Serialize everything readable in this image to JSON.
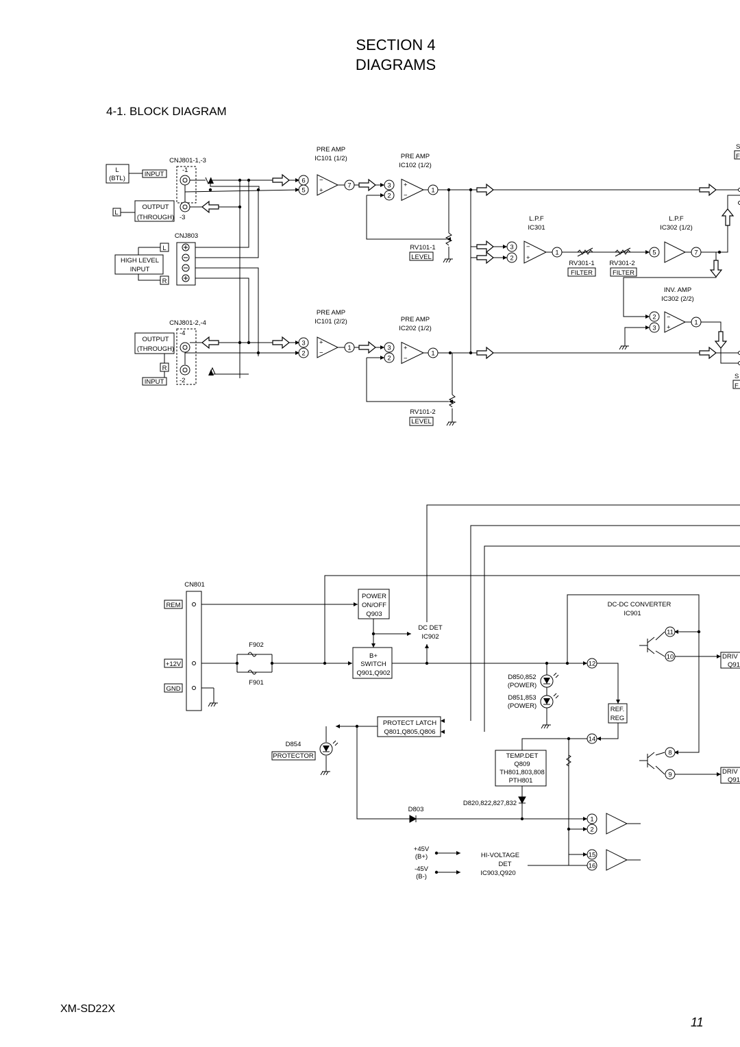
{
  "header": {
    "section": "SECTION 4",
    "title": "DIAGRAMS",
    "subtitle": "4-1. BLOCK DIAGRAM"
  },
  "footer": {
    "model": "XM-SD22X",
    "page": "11"
  },
  "labels": {
    "cnj801_13": "CNJ801-1,-3",
    "l": "L",
    "btl": "(BTL)",
    "input": "INPUT",
    "output": "OUTPUT",
    "through": "(THROUGH)",
    "p1": "-1",
    "p3": "-3",
    "l2": "L",
    "cnj803": "CNJ803",
    "l3": "L",
    "highlevel": "HIGH LEVEL",
    "hinput": "INPUT",
    "r": "R",
    "cnj801_24": "CNJ801-2,-4",
    "p4": "-4",
    "p2": "-2",
    "output2": "OUTPUT",
    "through2": "(THROUGH)",
    "r2": "R",
    "input2": "INPUT",
    "preamp1": "PRE AMP",
    "ic101a": "IC101 (1/2)",
    "preamp2": "PRE AMP",
    "ic102a": "IC102 (1/2)",
    "preamp3": "PRE AMP",
    "ic101b": "IC101 (2/2)",
    "preamp4": "PRE AMP",
    "ic202a": "IC202 (1/2)",
    "rv1011": "RV101-1",
    "level1": "LEVEL",
    "rv1012": "RV101-2",
    "level2": "LEVEL",
    "lpf1": "L.P.F",
    "ic301": "IC301",
    "lpf2": "L.P.F",
    "ic302a": "IC302 (1/2)",
    "rv3011": "RV301-1",
    "filter1": "FILTER",
    "rv3012": "RV301-2",
    "filter2": "FILTER",
    "invamp": "INV. AMP",
    "ic302b": "IC302 (2/2)",
    "s_top": "S",
    "f_top": "F",
    "s_bot": "S",
    "f_bot": "F",
    "cn801": "CN801",
    "rem": "REM",
    "v12": "+12V",
    "gnd": "GND",
    "power": "POWER",
    "onoff": "ON/OFF",
    "q903": "Q903",
    "dcdet": "DC DET",
    "ic902": "IC902",
    "f902": "F902",
    "f901": "F901",
    "bplus": "B+",
    "switch": "SWITCH",
    "q901": "Q901,Q902",
    "d850": "D850,852",
    "pow1": "(POWER)",
    "d851": "D851,853",
    "pow2": "(POWER)",
    "dcdc": "DC-DC CONVERTER",
    "ic901": "IC901",
    "ref": "REF.",
    "reg": "REG",
    "driv1": "DRIV",
    "q91a": "Q91",
    "driv2": "DRIV",
    "q91b": "Q91",
    "protect": "PROTECT LATCH",
    "q801": "Q801,Q805,Q806",
    "d854": "D854",
    "protector": "PROTECTOR",
    "tempdet": "TEMP.DET",
    "q809": "Q809",
    "th801": "TH801,803,808",
    "pth801": "PTH801",
    "d820": "D820,822,827,832",
    "d803": "D803",
    "p45": "+45V",
    "bp": "(B+)",
    "m45": "-45V",
    "bm": "(B-)",
    "hivolt": "HI-VOLTAGE",
    "det": "DET",
    "ic903": "IC903,Q920"
  },
  "pins": [
    "6",
    "5",
    "7",
    "3",
    "2",
    "1",
    "3",
    "2",
    "1",
    "3",
    "2",
    "1",
    "3",
    "2",
    "1",
    "3",
    "2",
    "1",
    "5",
    "7",
    "2",
    "3",
    "1",
    "11",
    "10",
    "12",
    "14",
    "8",
    "9",
    "1",
    "2",
    "15",
    "16"
  ]
}
